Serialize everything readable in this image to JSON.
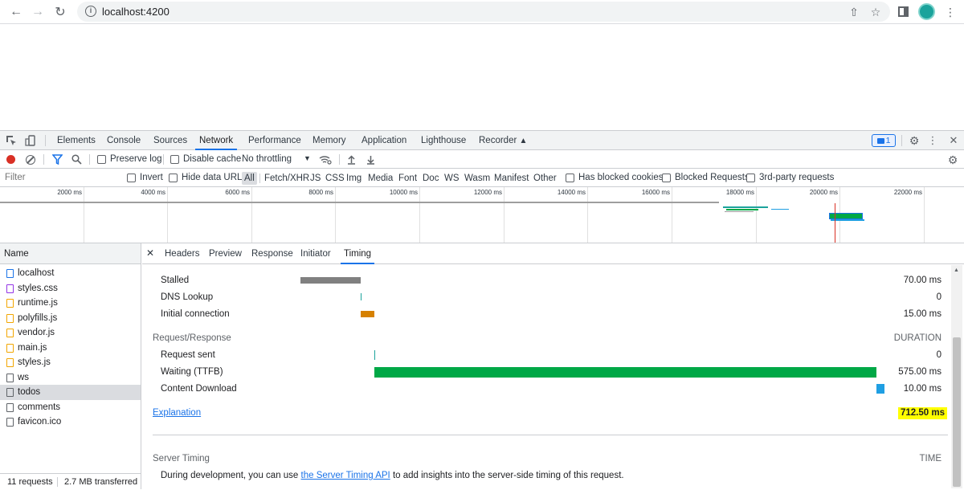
{
  "browser": {
    "url": "localhost:4200"
  },
  "devtools": {
    "tabs": [
      "Elements",
      "Console",
      "Sources",
      "Network",
      "Performance",
      "Memory",
      "Application",
      "Lighthouse",
      "Recorder"
    ],
    "active_tab": "Network",
    "issues_count": "1"
  },
  "toolbar": {
    "preserve_log": "Preserve log",
    "disable_cache": "Disable cache",
    "throttling": "No throttling"
  },
  "filter": {
    "placeholder": "Filter",
    "invert": "Invert",
    "hide_data_urls": "Hide data URLs",
    "types": [
      "All",
      "Fetch/XHR",
      "JS",
      "CSS",
      "Img",
      "Media",
      "Font",
      "Doc",
      "WS",
      "Wasm",
      "Manifest",
      "Other"
    ],
    "active_type": "All",
    "has_blocked_cookies": "Has blocked cookies",
    "blocked_requests": "Blocked Requests",
    "third_party": "3rd-party requests"
  },
  "overview": {
    "ticks": [
      "2000 ms",
      "4000 ms",
      "6000 ms",
      "8000 ms",
      "10000 ms",
      "12000 ms",
      "14000 ms",
      "16000 ms",
      "18000 ms",
      "20000 ms",
      "22000 ms"
    ]
  },
  "requests": {
    "header": "Name",
    "items": [
      {
        "name": "localhost",
        "kind": "doc"
      },
      {
        "name": "styles.css",
        "kind": "css"
      },
      {
        "name": "runtime.js",
        "kind": "js"
      },
      {
        "name": "polyfills.js",
        "kind": "js"
      },
      {
        "name": "vendor.js",
        "kind": "js"
      },
      {
        "name": "main.js",
        "kind": "js"
      },
      {
        "name": "styles.js",
        "kind": "js"
      },
      {
        "name": "ws",
        "kind": "other"
      },
      {
        "name": "todos",
        "kind": "other"
      },
      {
        "name": "comments",
        "kind": "other"
      },
      {
        "name": "favicon.ico",
        "kind": "other"
      }
    ],
    "selected": "todos",
    "footer_count": "11 requests",
    "footer_transferred": "2.7 MB transferred"
  },
  "detail": {
    "tabs": [
      "Headers",
      "Preview",
      "Response",
      "Initiator",
      "Timing"
    ],
    "active_tab": "Timing",
    "timing": {
      "stalled_label": "Stalled",
      "stalled_value": "70.00 ms",
      "dns_label": "DNS Lookup",
      "dns_value": "0",
      "initial_label": "Initial connection",
      "initial_value": "15.00 ms",
      "section_label": "Request/Response",
      "duration_label": "DURATION",
      "sent_label": "Request sent",
      "sent_value": "0",
      "waiting_label": "Waiting (TTFB)",
      "waiting_value": "575.00 ms",
      "download_label": "Content Download",
      "download_value": "10.00 ms",
      "explanation": "Explanation",
      "total": "712.50 ms",
      "server_timing_label": "Server Timing",
      "time_label": "TIME",
      "server_text_before": "During development, you can use ",
      "server_link": "the Server Timing API",
      "server_text_after": " to add insights into the server-side timing of this request."
    }
  },
  "colors": {
    "accent": "#1a73e8",
    "stalled": "#808080",
    "connection": "#d68100",
    "waiting": "#00a846",
    "download": "#1f9fe3",
    "highlight": "#ffff00",
    "record": "#d93025"
  }
}
